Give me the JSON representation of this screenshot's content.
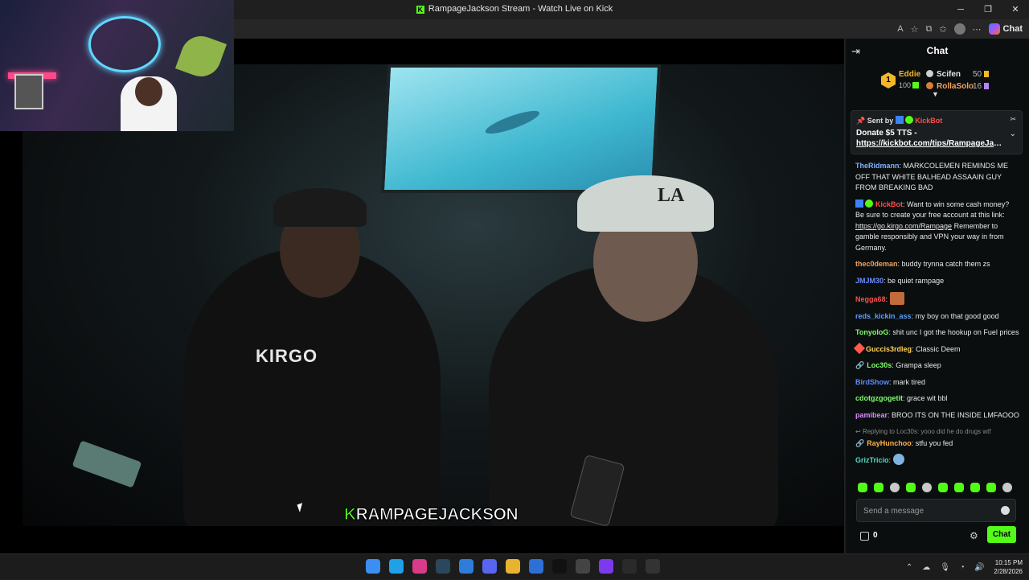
{
  "window": {
    "title": "RampageJackson Stream - Watch Live on Kick",
    "logo_letter": "K",
    "controls": [
      "─",
      "❐",
      "✕"
    ]
  },
  "toolbar": {
    "read_aloud": "A",
    "copilot_label": "Chat"
  },
  "stream": {
    "overlay_prefix": "K",
    "overlay_name": "RAMPAGEJACKSON",
    "shirt_logo": "KIRGO",
    "cap_logo": "LA"
  },
  "chat": {
    "title": "Chat",
    "leaderboard": {
      "first": {
        "rank": "1",
        "name": "Eddie",
        "value": "100"
      },
      "second": {
        "name": "Scifen",
        "value": "50"
      },
      "third": {
        "name": "RollaSolo",
        "value": "16"
      }
    },
    "pinned": {
      "label": "Sent by",
      "sender": "KickBot",
      "text": "Donate $5 TTS -",
      "link": "https://kickbot.com/tips/RampageJackson"
    },
    "messages": [
      {
        "user": "TheRidmann",
        "color": "#7fb3ff",
        "text": "MARKCOLEMEN REMINDS ME OFF THAT WHITE BALHEAD ASSAAIN GUY FROM BREAKING BAD"
      },
      {
        "user": "KickBot",
        "color": "#ff4d4d",
        "text": "Want to win some cash money? Be sure to create your free account at this link:",
        "link": "https://go.kirgo.com/Rampage",
        "text2": "Remember to gamble responsibly and VPN your way in from Germany."
      },
      {
        "user": "thec0deman",
        "color": "#f0a35e",
        "text": "buddy trynna catch them zs"
      },
      {
        "user": "JMJM30",
        "color": "#6b8cff",
        "text": "be quiet rampage"
      },
      {
        "user": "Negga68",
        "color": "#ff4d4d",
        "text": ""
      },
      {
        "user": "reds_kickin_ass",
        "color": "#5aa0ff",
        "text": "my boy on that good good"
      },
      {
        "user": "TonyoloG",
        "color": "#7dff6a",
        "text": "shit unc I got the hookup on Fuel prices"
      },
      {
        "user": "Guccis3rdleg",
        "color": "#ffd25a",
        "text": "Classic Deem"
      },
      {
        "user": "Loc30s",
        "color": "#7dff6a",
        "text": "Grampa sleep"
      },
      {
        "user": "BirdShow",
        "color": "#5a8cff",
        "text": "mark tired"
      },
      {
        "user": "cdotgzgogetit",
        "color": "#7dff6a",
        "text": "grace wit bbl"
      },
      {
        "user": "pamibear",
        "color": "#d88cff",
        "text": "BROO ITS ON THE INSIDE LMFAOOO"
      },
      {
        "reply": "Replying to Loc30s: yooo did he do drugs wtf",
        "user": "RayHunchoo",
        "color": "#ffb14a",
        "text": "stfu you fed"
      },
      {
        "user": "GrizTricio",
        "color": "#5ad8c4",
        "text": ""
      }
    ],
    "input_placeholder": "Send a message",
    "points": "0",
    "send_label": "Chat"
  },
  "taskbar": {
    "time": "10:15 PM",
    "date": "2/28/2026",
    "app_colors": [
      "#3a8ff0",
      "#1fa0e8",
      "#d83b8a",
      "#2a475e",
      "#2f7dd8",
      "#5865f2",
      "#e8b330",
      "#2d6fd6",
      "#111111",
      "#444444",
      "#7c3aed",
      "#2a2a2a",
      "#333333"
    ]
  }
}
